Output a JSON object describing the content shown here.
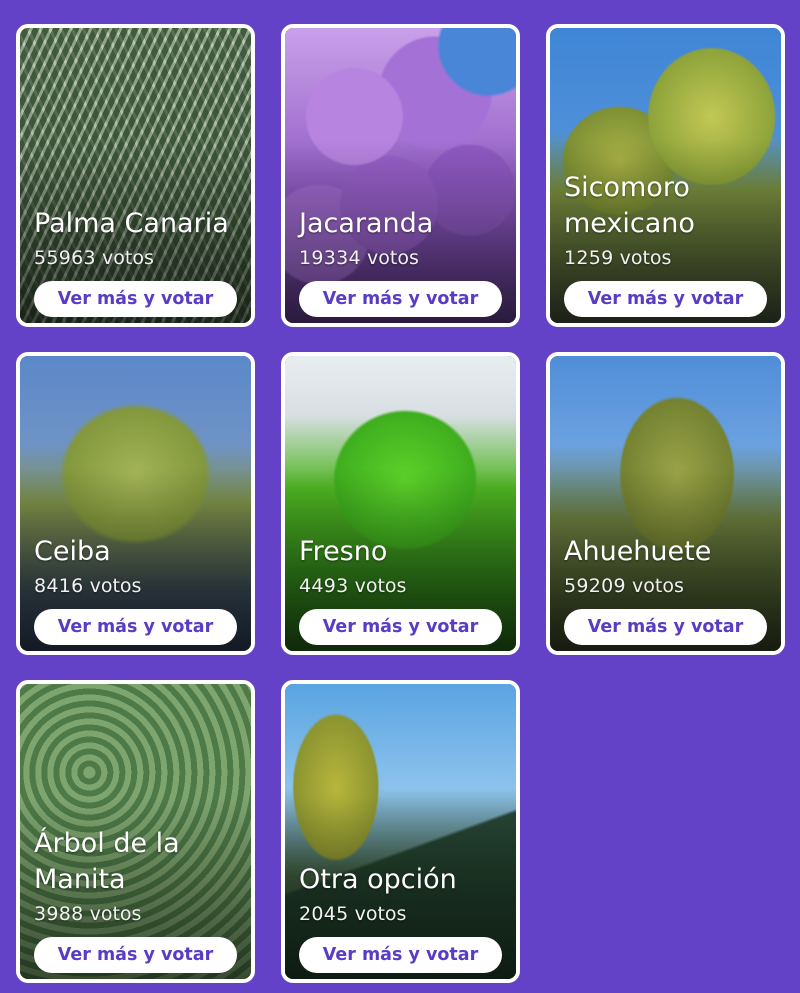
{
  "button_label": "Ver más y votar",
  "votes_suffix": "votos",
  "cards": [
    {
      "name": "Palma Canaria",
      "votes": "55963"
    },
    {
      "name": "Jacaranda",
      "votes": "19334"
    },
    {
      "name": "Sicomoro mexicano",
      "votes": "1259"
    },
    {
      "name": "Ceiba",
      "votes": "8416"
    },
    {
      "name": "Fresno",
      "votes": "4493"
    },
    {
      "name": "Ahuehuete",
      "votes": "59209"
    },
    {
      "name": "Árbol de la Manita",
      "votes": "3988"
    },
    {
      "name": "Otra opción",
      "votes": "2045"
    }
  ],
  "colors": {
    "background": "#6342c8",
    "accent": "#5a3cc4",
    "card_border": "#ffffff"
  }
}
